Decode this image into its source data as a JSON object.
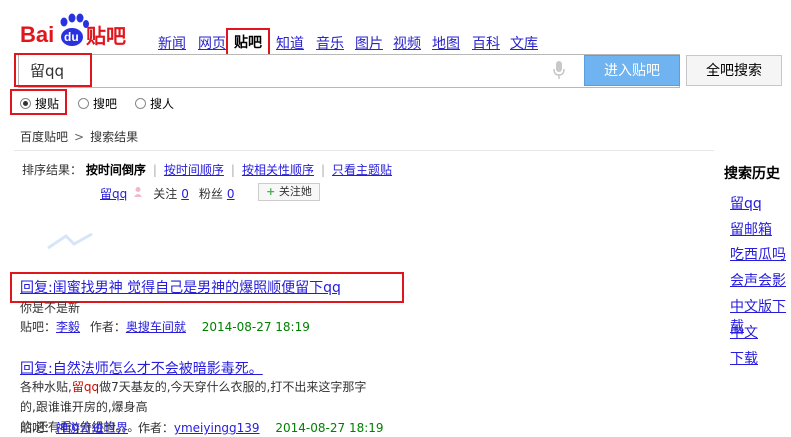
{
  "brand": {
    "logo_text_bai": "Bai",
    "logo_text_du": "du",
    "logo_text_tieba": "贴吧"
  },
  "nav": [
    "新闻",
    "网页",
    "贴吧",
    "知道",
    "音乐",
    "图片",
    "视频",
    "地图",
    "百科",
    "文库"
  ],
  "search": {
    "value": "留qq",
    "enter_button": "进入贴吧",
    "all_button": "全吧搜索"
  },
  "radios": [
    {
      "label": "搜贴",
      "checked": true
    },
    {
      "label": "搜吧",
      "checked": false
    },
    {
      "label": "搜人",
      "checked": false
    }
  ],
  "breadcrumb": {
    "home": "百度贴吧",
    "sep": ">",
    "current": "搜索结果"
  },
  "sort": {
    "label": "排序结果：",
    "active": "按时间倒序",
    "options": [
      "按时间顺序",
      "按相关性顺序",
      "只看主题贴"
    ]
  },
  "user": {
    "name": "留qq",
    "follow_label": "关注",
    "follow_count": "0",
    "fans_label": "粉丝",
    "fans_count": "0",
    "follow_button": "关注她"
  },
  "results": [
    {
      "title": "回复:闺蜜找男神 觉得自己是男神的爆照顺便留下qq",
      "snippet": "你是不是新",
      "bar_label": "贴吧：",
      "bar": "李毅",
      "author_label": "作者：",
      "author": "奥搜车间就",
      "date": "2014-08-27 18:19"
    },
    {
      "title": "回复:自然法师怎么才不会被暗影毒死。",
      "snippet_pre": "各种水贴,",
      "snippet_hl": "留qq",
      "snippet_post": "做7天基友的,今天穿什么衣服的,打不出来这字那字的,跟谁谁开房的,爆身高",
      "snippet_line2": "的,还有看q分组的。。。...",
      "bar_label": "贴吧：",
      "bar": "神游奇迹世界",
      "author_label": "作者：",
      "author": "ymeiyingg139",
      "date": "2014-08-27 18:19"
    }
  ],
  "sidebar": {
    "title": "搜索历史",
    "items": [
      "留qq",
      "留邮箱",
      "吃西瓜吗",
      "会声会影",
      "中文版下载",
      "中文",
      "下载"
    ]
  }
}
